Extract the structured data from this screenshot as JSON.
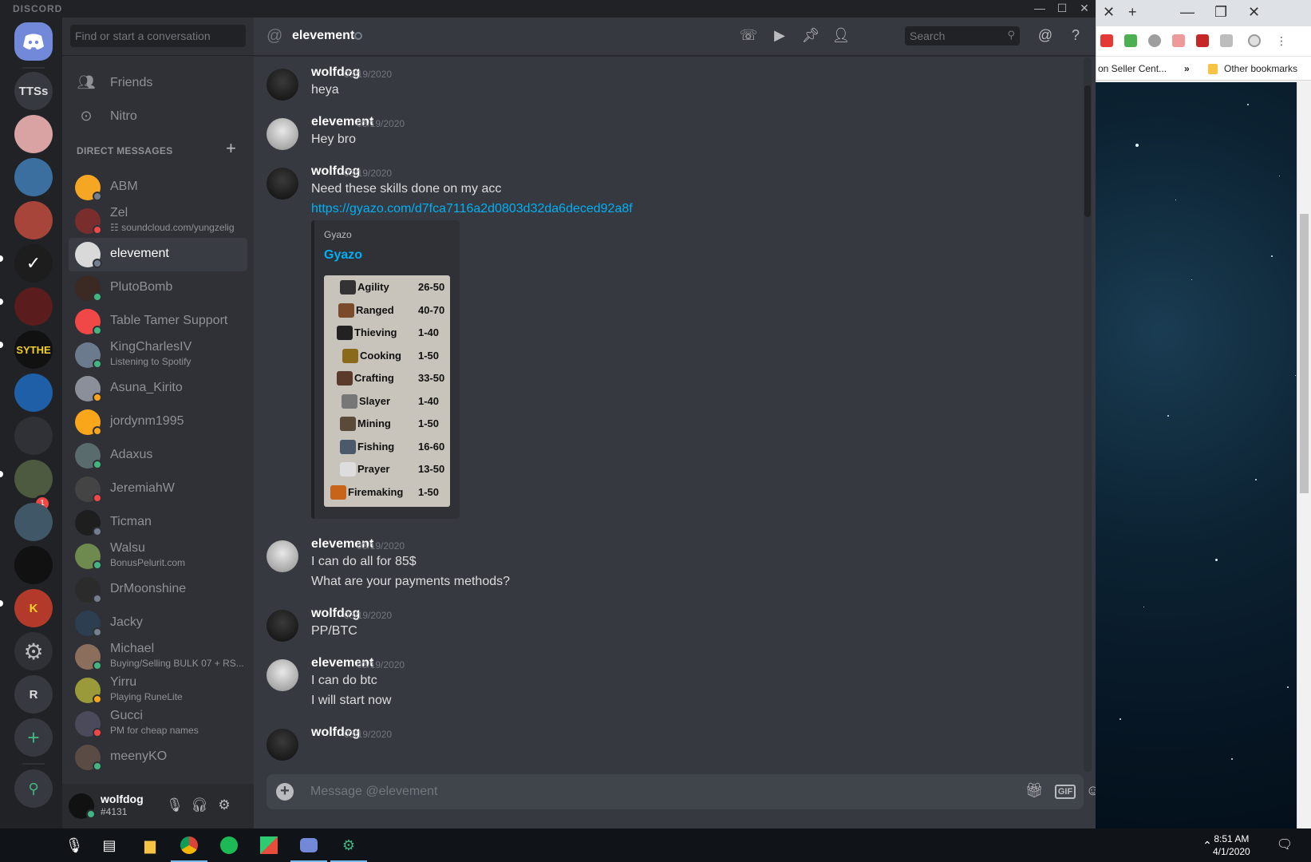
{
  "discord": {
    "brand": "DISCORD",
    "rail": {
      "servers": [
        "TTSs",
        "SYTHE",
        "R"
      ],
      "badge_count": "1"
    },
    "dm_sidebar": {
      "search_placeholder": "Find or start a conversation",
      "nav": [
        {
          "label": "Friends",
          "icon": "friends-icon"
        },
        {
          "label": "Nitro",
          "icon": "nitro-icon"
        }
      ],
      "header": "DIRECT MESSAGES",
      "dms": [
        {
          "name": "ABM",
          "sub": "",
          "status": "offline",
          "color": "#f5a623"
        },
        {
          "name": "Zel",
          "sub": "☷ soundcloud.com/yungzelig",
          "status": "dnd",
          "color": "#7a2d2d"
        },
        {
          "name": "elevement",
          "sub": "",
          "status": "offline",
          "color": "#d9d9d9",
          "active": true
        },
        {
          "name": "PlutoBomb",
          "sub": "",
          "status": "online",
          "color": "#3b2a24"
        },
        {
          "name": "Table Tamer Support",
          "sub": "",
          "status": "online",
          "color": "#f04747"
        },
        {
          "name": "KingCharlesIV",
          "sub": "Listening to Spotify",
          "status": "online",
          "color": "#6b7a8c"
        },
        {
          "name": "Asuna_Kirito",
          "sub": "",
          "status": "idle",
          "color": "#8a8f99"
        },
        {
          "name": "jordynm1995",
          "sub": "",
          "status": "idle",
          "color": "#faa61a"
        },
        {
          "name": "Adaxus",
          "sub": "",
          "status": "online",
          "color": "#5a6b6e"
        },
        {
          "name": "JeremiahW",
          "sub": "",
          "status": "dnd",
          "color": "#444"
        },
        {
          "name": "Ticman",
          "sub": "",
          "status": "offline",
          "color": "#1e1e1e"
        },
        {
          "name": "Walsu",
          "sub": "BonusPelurit.com",
          "status": "online",
          "color": "#6e8a4e"
        },
        {
          "name": "DrMoonshine",
          "sub": "",
          "status": "offline",
          "color": "#2b2b2b"
        },
        {
          "name": "Jacky",
          "sub": "",
          "status": "offline",
          "color": "#2c3e50"
        },
        {
          "name": "Michael",
          "sub": "Buying/Selling BULK 07 + RS...",
          "status": "online",
          "color": "#8c6e5d"
        },
        {
          "name": "Yirru",
          "sub": "Playing RuneLite",
          "status": "idle",
          "color": "#9a9a3a"
        },
        {
          "name": "Gucci",
          "sub": "PM for cheap names",
          "status": "dnd",
          "color": "#4a4a5a"
        },
        {
          "name": "meenyKO",
          "sub": "",
          "status": "online",
          "color": "#5b4b45"
        }
      ],
      "user": {
        "name": "wolfdog",
        "tag": "#4131"
      }
    },
    "channel": {
      "name": "elevement",
      "search_placeholder": "Search"
    },
    "messages": [
      {
        "author": "wolfdog",
        "time": "03/19/2020",
        "lines": [
          "heya"
        ]
      },
      {
        "author": "elevement",
        "time": "03/19/2020",
        "lines": [
          "Hey bro"
        ]
      },
      {
        "author": "wolfdog",
        "time": "03/19/2020",
        "lines": [
          "Need these skills done on my acc"
        ],
        "link": "https://gyazo.com/d7fca7116a2d0803d32da6deced92a8f",
        "embed": {
          "provider": "Gyazo",
          "title": "Gyazo",
          "skills": [
            {
              "name": "Agility",
              "range": "26-50"
            },
            {
              "name": "Ranged",
              "range": "40-70"
            },
            {
              "name": "Thieving",
              "range": "1-40"
            },
            {
              "name": "Cooking",
              "range": "1-50"
            },
            {
              "name": "Crafting",
              "range": "33-50"
            },
            {
              "name": "Slayer",
              "range": "1-40"
            },
            {
              "name": "Mining",
              "range": "1-50"
            },
            {
              "name": "Fishing",
              "range": "16-60"
            },
            {
              "name": "Prayer",
              "range": "13-50"
            },
            {
              "name": "Firemaking",
              "range": "1-50"
            }
          ]
        }
      },
      {
        "author": "elevement",
        "time": "03/19/2020",
        "lines": [
          "I can do all for 85$",
          "What are your payments methods?"
        ]
      },
      {
        "author": "wolfdog",
        "time": "03/19/2020",
        "lines": [
          "PP/BTC"
        ]
      },
      {
        "author": "elevement",
        "time": "03/19/2020",
        "lines": [
          "I can do btc",
          "I will start now"
        ]
      },
      {
        "author": "wolfdog",
        "time": "03/19/2020",
        "lines": []
      }
    ],
    "composer": {
      "placeholder": "Message @elevement",
      "gif_label": "GIF"
    }
  },
  "browser": {
    "bookmark_item": "on Seller Cent...",
    "more": "»",
    "other_bookmarks": "Other bookmarks"
  },
  "taskbar": {
    "time": "8:51 AM",
    "date": "4/1/2020"
  },
  "colors": {
    "online": "#43b581",
    "idle": "#faa61a",
    "dnd": "#f04747",
    "offline": "#747f8d",
    "link": "#00b0f4",
    "blurple": "#7289da"
  }
}
